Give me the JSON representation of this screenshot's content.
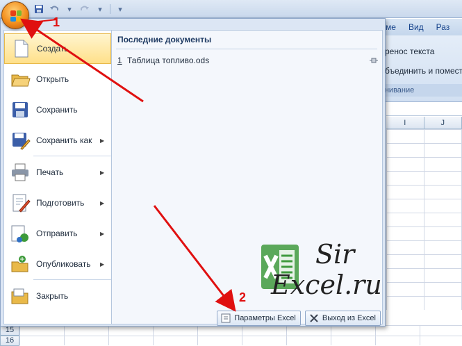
{
  "ribbon": {
    "tabs": [
      "ме",
      "Вид",
      "Раз"
    ],
    "wrap_text": "ренос текста",
    "merge": "бъединить и помест",
    "group_label": "внивание",
    "col_headers": [
      "I",
      "J"
    ]
  },
  "rows": {
    "r15": "15",
    "r16": "16"
  },
  "menu": {
    "items": [
      {
        "label": "Создать",
        "icon": "new-document-icon",
        "submenu": false
      },
      {
        "label": "Открыть",
        "icon": "open-folder-icon",
        "submenu": false
      },
      {
        "label": "Сохранить",
        "icon": "save-disk-icon",
        "submenu": false
      },
      {
        "label": "Сохранить как",
        "icon": "save-as-icon",
        "submenu": true
      },
      {
        "label": "Печать",
        "icon": "printer-icon",
        "submenu": true
      },
      {
        "label": "Подготовить",
        "icon": "prepare-icon",
        "submenu": true
      },
      {
        "label": "Отправить",
        "icon": "send-icon",
        "submenu": true
      },
      {
        "label": "Опубликовать",
        "icon": "publish-icon",
        "submenu": true
      },
      {
        "label": "Закрыть",
        "icon": "close-folder-icon",
        "submenu": false
      }
    ],
    "recent_title": "Последние документы",
    "recent_docs": [
      {
        "index": "1",
        "name": "Таблица топливо.ods"
      }
    ],
    "options_button": "Параметры Excel",
    "exit_button": "Выход из Excel"
  },
  "annotations": {
    "step1": "1",
    "step2": "2"
  },
  "watermark": {
    "line1": "Sir",
    "line2": "Excel.ru"
  },
  "colors": {
    "accent": "#ffe08a",
    "arrow": "#e01010",
    "menu_bg": "#dce6f4"
  }
}
